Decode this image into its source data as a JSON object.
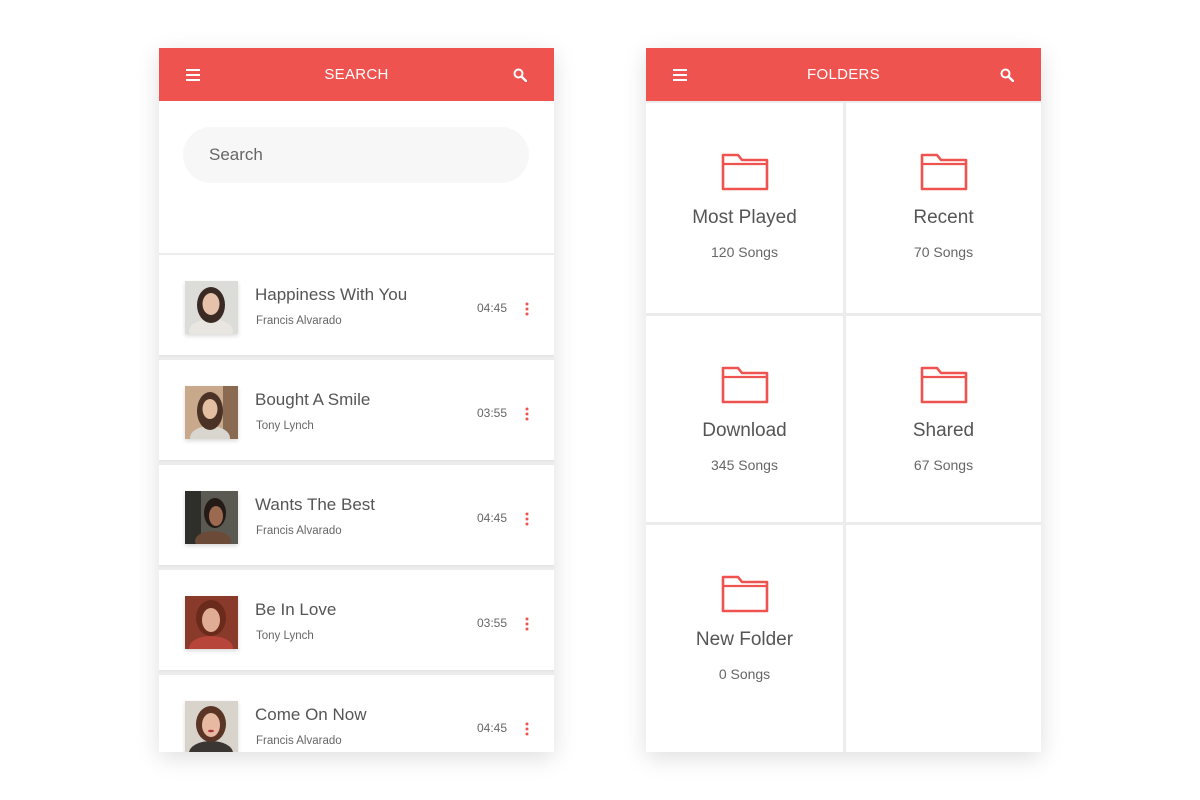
{
  "colors": {
    "accent": "#ef5350",
    "text": "#555555",
    "muted": "#666666",
    "background": "#ffffff",
    "divider": "#ececec"
  },
  "search_screen": {
    "header": {
      "title": "SEARCH",
      "left_icon": "menu-icon",
      "right_icon": "search-icon"
    },
    "search": {
      "placeholder": "Search",
      "value": ""
    },
    "songs": [
      {
        "title": "Happiness With You",
        "artist": "Francis Alvarado",
        "duration": "04:45"
      },
      {
        "title": "Bought A Smile",
        "artist": "Tony Lynch",
        "duration": "03:55"
      },
      {
        "title": "Wants The Best",
        "artist": "Francis Alvarado",
        "duration": "04:45"
      },
      {
        "title": "Be In Love",
        "artist": "Tony Lynch",
        "duration": "03:55"
      },
      {
        "title": "Come On Now",
        "artist": "Francis Alvarado",
        "duration": "04:45"
      }
    ]
  },
  "folders_screen": {
    "header": {
      "title": "FOLDERS",
      "left_icon": "menu-icon",
      "right_icon": "search-icon"
    },
    "folders": [
      {
        "name": "Most Played",
        "count": "120 Songs"
      },
      {
        "name": "Recent",
        "count": "70 Songs"
      },
      {
        "name": "Download",
        "count": "345 Songs"
      },
      {
        "name": "Shared",
        "count": "67 Songs"
      },
      {
        "name": "New Folder",
        "count": "0 Songs"
      }
    ]
  }
}
